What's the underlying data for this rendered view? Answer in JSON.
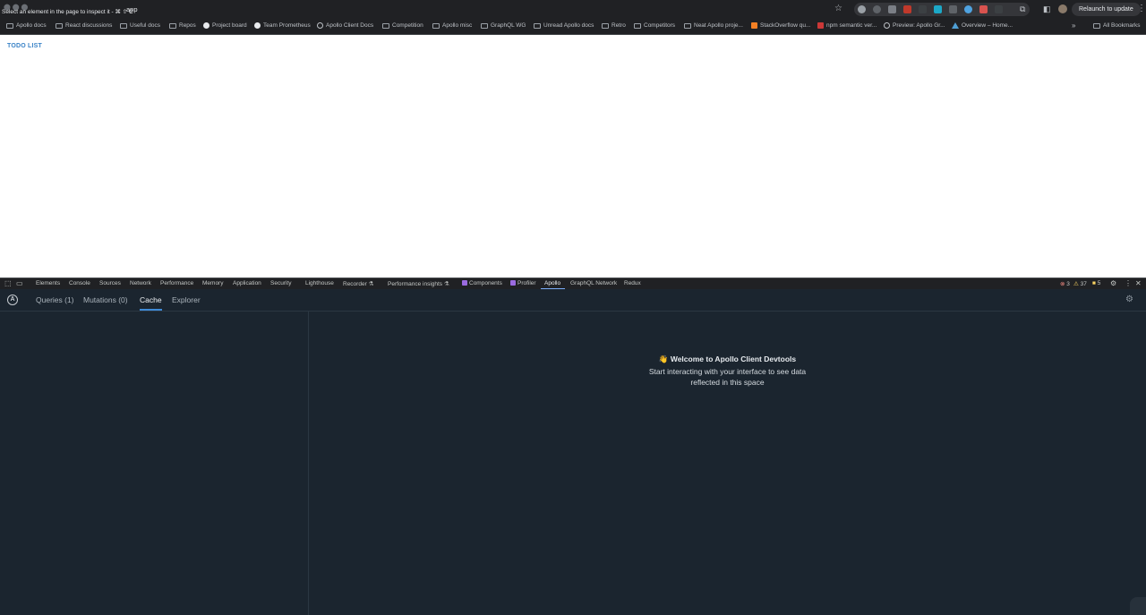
{
  "browser": {
    "tooltip": "Select an element in the page to inspect it - ⌘ ⇧ C",
    "url": "app",
    "relaunch": "Relaunch to update",
    "bookmarks": [
      {
        "label": "Apollo docs",
        "icon": "folder"
      },
      {
        "label": "React discussions",
        "icon": "folder"
      },
      {
        "label": "Useful docs",
        "icon": "folder"
      },
      {
        "label": "Repos",
        "icon": "folder"
      },
      {
        "label": "Project board",
        "icon": "github"
      },
      {
        "label": "Team Prometheus",
        "icon": "github"
      },
      {
        "label": "Apollo Client Docs",
        "icon": "apollo"
      },
      {
        "label": "Competition",
        "icon": "folder"
      },
      {
        "label": "Apollo misc",
        "icon": "folder"
      },
      {
        "label": "GraphQL WG",
        "icon": "folder"
      },
      {
        "label": "Unread Apollo docs",
        "icon": "folder"
      },
      {
        "label": "Retro",
        "icon": "folder"
      },
      {
        "label": "Competitors",
        "icon": "folder"
      },
      {
        "label": "Neat Apollo proje...",
        "icon": "folder"
      },
      {
        "label": "StackOverflow qu...",
        "icon": "stackoverflow"
      },
      {
        "label": "npm semantic ver...",
        "icon": "npm"
      },
      {
        "label": "Preview: Apollo Gr...",
        "icon": "globe"
      },
      {
        "label": "Overview – Home...",
        "icon": "triangle"
      }
    ],
    "all_bookmarks": "All Bookmarks"
  },
  "page": {
    "heading": "TODO LIST"
  },
  "devtools": {
    "tabs": [
      "Elements",
      "Console",
      "Sources",
      "Network",
      "Performance",
      "Memory",
      "Application",
      "Security",
      "Lighthouse",
      "Recorder ⚗",
      "Performance insights ⚗",
      "Components",
      "Profiler",
      "Apollo",
      "GraphQL Network",
      "Redux"
    ],
    "active_tab": "Apollo",
    "errors": "3",
    "warnings": "37",
    "issues": "5"
  },
  "apollo": {
    "tabs": [
      "Queries (1)",
      "Mutations (0)",
      "Cache",
      "Explorer"
    ],
    "active_tab": "Cache",
    "welcome_title": "👋 Welcome to Apollo Client Devtools",
    "welcome_body_1": "Start interacting with your interface to see data",
    "welcome_body_2": "reflected in this space",
    "colors": {
      "accent": "#3f8ad6",
      "panel_bg": "#1b252f",
      "todo_heading": "#3a83c7"
    }
  }
}
